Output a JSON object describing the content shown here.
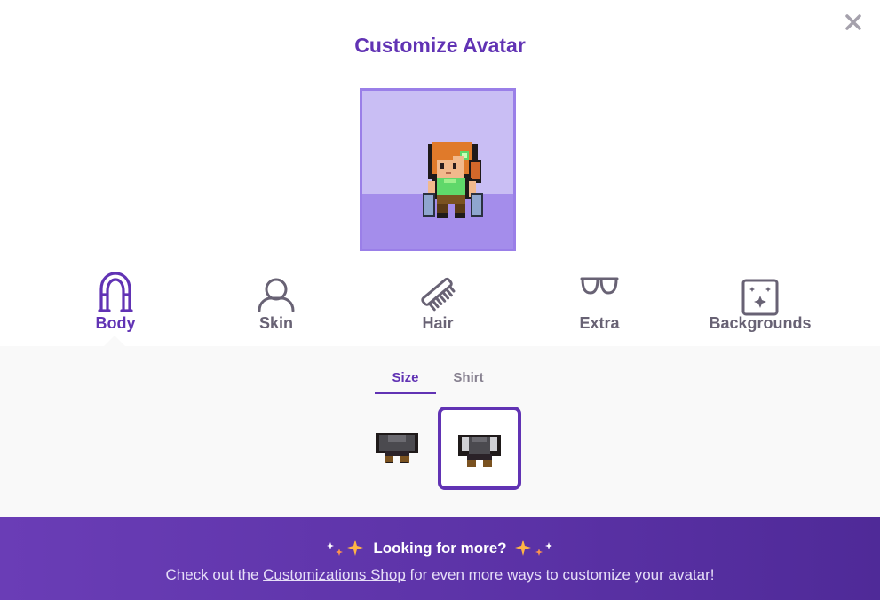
{
  "dialog": {
    "title": "Customize Avatar",
    "close_icon": "close-icon"
  },
  "avatar_preview": {
    "background_color": "#c9bef4",
    "floor_color": "#a48deb",
    "border_color": "#9a7fe8"
  },
  "categories": [
    {
      "label": "Body",
      "icon": "body-icon",
      "active": true
    },
    {
      "label": "Skin",
      "icon": "skin-icon",
      "active": false
    },
    {
      "label": "Hair",
      "icon": "comb-icon",
      "active": false
    },
    {
      "label": "Extra",
      "icon": "glasses-icon",
      "active": false
    },
    {
      "label": "Backgrounds",
      "icon": "sparkle-background-icon",
      "active": false
    }
  ],
  "subtabs": [
    {
      "label": "Size",
      "active": true
    },
    {
      "label": "Shirt",
      "active": false
    }
  ],
  "options": [
    {
      "name": "slim",
      "selected": false
    },
    {
      "name": "broad",
      "selected": true
    }
  ],
  "banner": {
    "heading": "Looking for more?",
    "text_before": "Check out the ",
    "link_text": "Customizations Shop",
    "text_after": " for even more ways to customize your avatar!"
  },
  "colors": {
    "accent": "#6133b4",
    "banner": "#5b32a6",
    "sparkle": "#ffb445"
  }
}
